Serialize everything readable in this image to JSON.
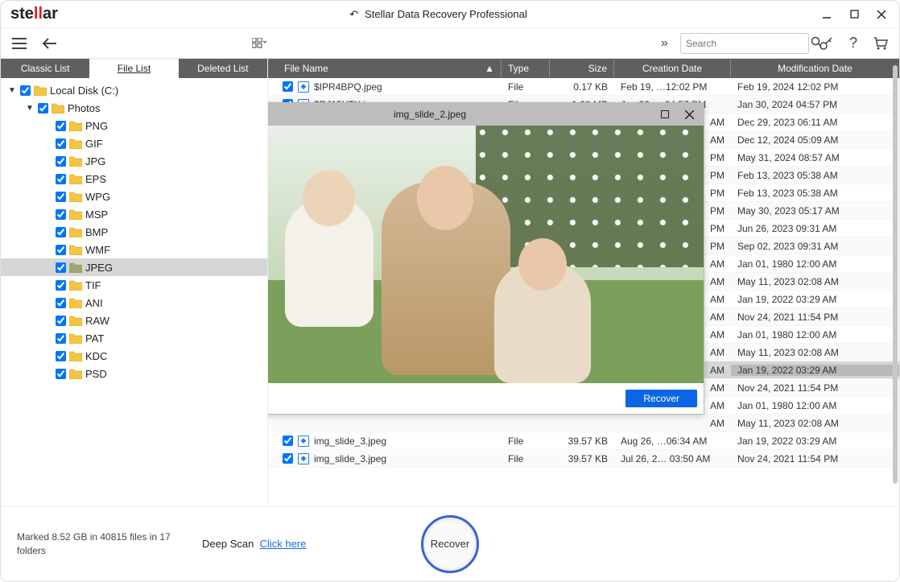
{
  "logo": {
    "pre": "ste",
    "mid": "ll",
    "post": "ar"
  },
  "app_title": "Stellar Data Recovery Professional",
  "search_placeholder": "Search",
  "tabs": {
    "classic": "Classic List",
    "file": "File List",
    "deleted": "Deleted List"
  },
  "tree": [
    {
      "depth": 0,
      "caret": "▼",
      "label": "Local Disk (C:)",
      "selected": false,
      "open": false
    },
    {
      "depth": 1,
      "caret": "▼",
      "label": "Photos",
      "selected": false,
      "open": false
    },
    {
      "depth": 2,
      "caret": "",
      "label": "PNG",
      "selected": false,
      "open": false
    },
    {
      "depth": 2,
      "caret": "",
      "label": "GIF",
      "selected": false,
      "open": false
    },
    {
      "depth": 2,
      "caret": "",
      "label": "JPG",
      "selected": false,
      "open": false
    },
    {
      "depth": 2,
      "caret": "",
      "label": "EPS",
      "selected": false,
      "open": false
    },
    {
      "depth": 2,
      "caret": "",
      "label": "WPG",
      "selected": false,
      "open": false
    },
    {
      "depth": 2,
      "caret": "",
      "label": "MSP",
      "selected": false,
      "open": false
    },
    {
      "depth": 2,
      "caret": "",
      "label": "BMP",
      "selected": false,
      "open": false
    },
    {
      "depth": 2,
      "caret": "",
      "label": "WMF",
      "selected": false,
      "open": false
    },
    {
      "depth": 2,
      "caret": "",
      "label": "JPEG",
      "selected": true,
      "open": true
    },
    {
      "depth": 2,
      "caret": "",
      "label": "TIF",
      "selected": false,
      "open": false
    },
    {
      "depth": 2,
      "caret": "",
      "label": "ANI",
      "selected": false,
      "open": false
    },
    {
      "depth": 2,
      "caret": "",
      "label": "RAW",
      "selected": false,
      "open": false
    },
    {
      "depth": 2,
      "caret": "",
      "label": "PAT",
      "selected": false,
      "open": false
    },
    {
      "depth": 2,
      "caret": "",
      "label": "KDC",
      "selected": false,
      "open": false
    },
    {
      "depth": 2,
      "caret": "",
      "label": "PSD",
      "selected": false,
      "open": false
    }
  ],
  "grid": {
    "headers": {
      "name": "File Name",
      "type": "Type",
      "size": "Size",
      "cdate": "Creation Date",
      "mdate": "Modification Date"
    },
    "rows": [
      {
        "name": "$IPR4BPQ.jpeg",
        "type": "File",
        "size": "0.17 KB",
        "cdate": "Feb 19, …12:02 PM",
        "mdate": "Feb 19, 2024 12:02 PM",
        "hilite": false
      },
      {
        "name": "$RJ15YTX.jpeg",
        "type": "File",
        "size": "1.08 MB",
        "cdate": "Jan 30, …04:57 PM",
        "mdate": "Jan 30, 2024 04:57 PM",
        "hilite": false
      },
      {
        "name": "",
        "type": "",
        "size": "",
        "cdate": "AM",
        "mdate": "Dec 29, 2023 06:11 AM",
        "hilite": false,
        "short": true
      },
      {
        "name": "",
        "type": "",
        "size": "",
        "cdate": "AM",
        "mdate": "Dec 12, 2024 05:09 AM",
        "hilite": false,
        "short": true
      },
      {
        "name": "",
        "type": "",
        "size": "",
        "cdate": "PM",
        "mdate": "May 31, 2024 08:57 AM",
        "hilite": false,
        "short": true
      },
      {
        "name": "",
        "type": "",
        "size": "",
        "cdate": "PM",
        "mdate": "Feb 13, 2023 05:38 AM",
        "hilite": false,
        "short": true
      },
      {
        "name": "",
        "type": "",
        "size": "",
        "cdate": "PM",
        "mdate": "Feb 13, 2023 05:38 AM",
        "hilite": false,
        "short": true
      },
      {
        "name": "",
        "type": "",
        "size": "",
        "cdate": "PM",
        "mdate": "May 30, 2023 05:17 AM",
        "hilite": false,
        "short": true
      },
      {
        "name": "",
        "type": "",
        "size": "",
        "cdate": "PM",
        "mdate": "Jun 26, 2023 09:31 AM",
        "hilite": false,
        "short": true
      },
      {
        "name": "",
        "type": "",
        "size": "",
        "cdate": "PM",
        "mdate": "Sep 02, 2023 09:31 AM",
        "hilite": false,
        "short": true
      },
      {
        "name": "",
        "type": "",
        "size": "",
        "cdate": "AM",
        "mdate": "Jan 01, 1980 12:00 AM",
        "hilite": false,
        "short": true
      },
      {
        "name": "",
        "type": "",
        "size": "",
        "cdate": "AM",
        "mdate": "May 11, 2023 02:08 AM",
        "hilite": false,
        "short": true
      },
      {
        "name": "",
        "type": "",
        "size": "",
        "cdate": "AM",
        "mdate": "Jan 19, 2022 03:29 AM",
        "hilite": false,
        "short": true
      },
      {
        "name": "",
        "type": "",
        "size": "",
        "cdate": "AM",
        "mdate": "Nov 24, 2021 11:54 PM",
        "hilite": false,
        "short": true
      },
      {
        "name": "",
        "type": "",
        "size": "",
        "cdate": "AM",
        "mdate": "Jan 01, 1980 12:00 AM",
        "hilite": false,
        "short": true
      },
      {
        "name": "",
        "type": "",
        "size": "",
        "cdate": "AM",
        "mdate": "May 11, 2023 02:08 AM",
        "hilite": false,
        "short": true
      },
      {
        "name": "",
        "type": "",
        "size": "",
        "cdate": "AM",
        "mdate": "Jan 19, 2022 03:29 AM",
        "hilite": true,
        "short": true
      },
      {
        "name": "",
        "type": "",
        "size": "",
        "cdate": "AM",
        "mdate": "Nov 24, 2021 11:54 PM",
        "hilite": false,
        "short": true
      },
      {
        "name": "",
        "type": "",
        "size": "",
        "cdate": "AM",
        "mdate": "Jan 01, 1980 12:00 AM",
        "hilite": false,
        "short": true
      },
      {
        "name": "",
        "type": "",
        "size": "",
        "cdate": "AM",
        "mdate": "May 11, 2023 02:08 AM",
        "hilite": false,
        "short": true
      },
      {
        "name": "img_slide_3.jpeg",
        "type": "File",
        "size": "39.57 KB",
        "cdate": "Aug 26, …06:34 AM",
        "mdate": "Jan 19, 2022 03:29 AM",
        "hilite": false
      },
      {
        "name": "img_slide_3.jpeg",
        "type": "File",
        "size": "39.57 KB",
        "cdate": "Jul 26, 2… 03:50 AM",
        "mdate": "Nov 24, 2021 11:54 PM",
        "hilite": false
      }
    ]
  },
  "preview": {
    "title": "img_slide_2.jpeg",
    "recover": "Recover"
  },
  "footer": {
    "marked": "Marked 8.52 GB in 40815 files in 17 folders",
    "deepscan_label": "Deep Scan",
    "deepscan_link": "Click here",
    "recover": "Recover"
  }
}
